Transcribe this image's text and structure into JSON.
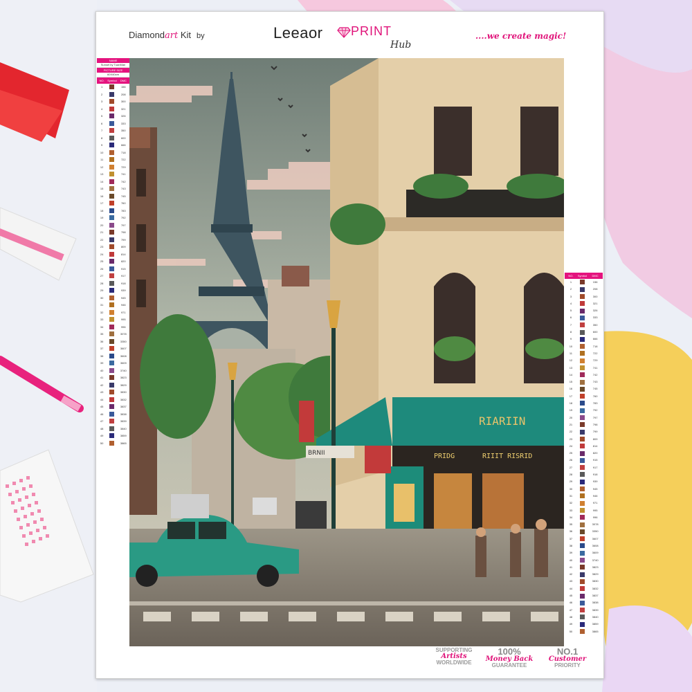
{
  "header": {
    "brand_left_prefix": "Diamond",
    "brand_left_art": "art",
    "brand_left_suffix": " Kit",
    "brand_by": "by",
    "brand_leeaor": "Leeaor",
    "brand_print": "PRINT",
    "brand_hub": "Hub",
    "tagline": "....we create magic!"
  },
  "left_legend": {
    "name_header": "NAME",
    "name_value": "Sunset by TuanMan",
    "size_header": "PICTURE SIZE",
    "size_value": "60X40cm",
    "col_no": "NO.",
    "col_symbol": "Symbol",
    "col_dmc": "DMC",
    "rows": [
      [
        "1",
        "156"
      ],
      [
        "2",
        "208"
      ],
      [
        "3",
        "300"
      ],
      [
        "4",
        "321"
      ],
      [
        "5",
        "326"
      ],
      [
        "6",
        "333"
      ],
      [
        "7",
        "350"
      ],
      [
        "8",
        "600"
      ],
      [
        "9",
        "666"
      ],
      [
        "10",
        "718"
      ],
      [
        "11",
        "722"
      ],
      [
        "12",
        "729"
      ],
      [
        "13",
        "741"
      ],
      [
        "14",
        "742"
      ],
      [
        "15",
        "743"
      ],
      [
        "16",
        "745"
      ],
      [
        "17",
        "760"
      ],
      [
        "18",
        "783"
      ],
      [
        "19",
        "792"
      ],
      [
        "20",
        "797"
      ],
      [
        "21",
        "798"
      ],
      [
        "22",
        "799"
      ],
      [
        "23",
        "809"
      ],
      [
        "24",
        "814"
      ],
      [
        "25",
        "820"
      ],
      [
        "26",
        "915"
      ],
      [
        "27",
        "917"
      ],
      [
        "28",
        "918"
      ],
      [
        "29",
        "939"
      ],
      [
        "30",
        "945"
      ],
      [
        "31",
        "946"
      ],
      [
        "32",
        "971"
      ],
      [
        "33",
        "995"
      ],
      [
        "34",
        "996"
      ],
      [
        "35",
        "3078"
      ],
      [
        "36",
        "3350"
      ],
      [
        "37",
        "3607"
      ],
      [
        "38",
        "3608"
      ],
      [
        "39",
        "3609"
      ],
      [
        "40",
        "3740"
      ],
      [
        "41",
        "3823"
      ],
      [
        "42",
        "3829"
      ],
      [
        "43",
        "3830"
      ],
      [
        "44",
        "3832"
      ],
      [
        "45",
        "3837"
      ],
      [
        "46",
        "3838"
      ],
      [
        "47",
        "3839"
      ],
      [
        "48",
        "3840"
      ],
      [
        "49",
        "3859"
      ],
      [
        "50",
        "3865"
      ]
    ]
  },
  "right_legend": {
    "col_no": "NO.",
    "col_symbol": "Symbol",
    "col_dmc": "DMC"
  },
  "badges": {
    "b1_l1": "SUPPORTING",
    "b1_l2": "Artists",
    "b1_l3": "WORLDWIDE",
    "b2_l1": "100%",
    "b2_l2": "Money Back",
    "b2_l3": "GUARANTEE",
    "b3_l1": "NO.1",
    "b3_l2": "Customer",
    "b3_l3": "PRIORITY"
  },
  "scene": {
    "shop_sign": "RIARIIN",
    "shop_sub_left": "PRIDG",
    "shop_sub_right": "RIIIT RISRID",
    "street_sign": "BRNII",
    "symbol_colors": [
      "#7a3a2a",
      "#3a3a6a",
      "#a04a2a",
      "#c03a3a",
      "#6a2a6a",
      "#3a5a9a",
      "#c04040",
      "#5a5a5a",
      "#2a2a7a",
      "#b06030",
      "#b07020",
      "#d08030",
      "#c09030",
      "#a02a5a",
      "#a07040",
      "#6a4a2a",
      "#c0402a",
      "#2a4a8a",
      "#3a6aa0",
      "#8a4a8a"
    ]
  }
}
